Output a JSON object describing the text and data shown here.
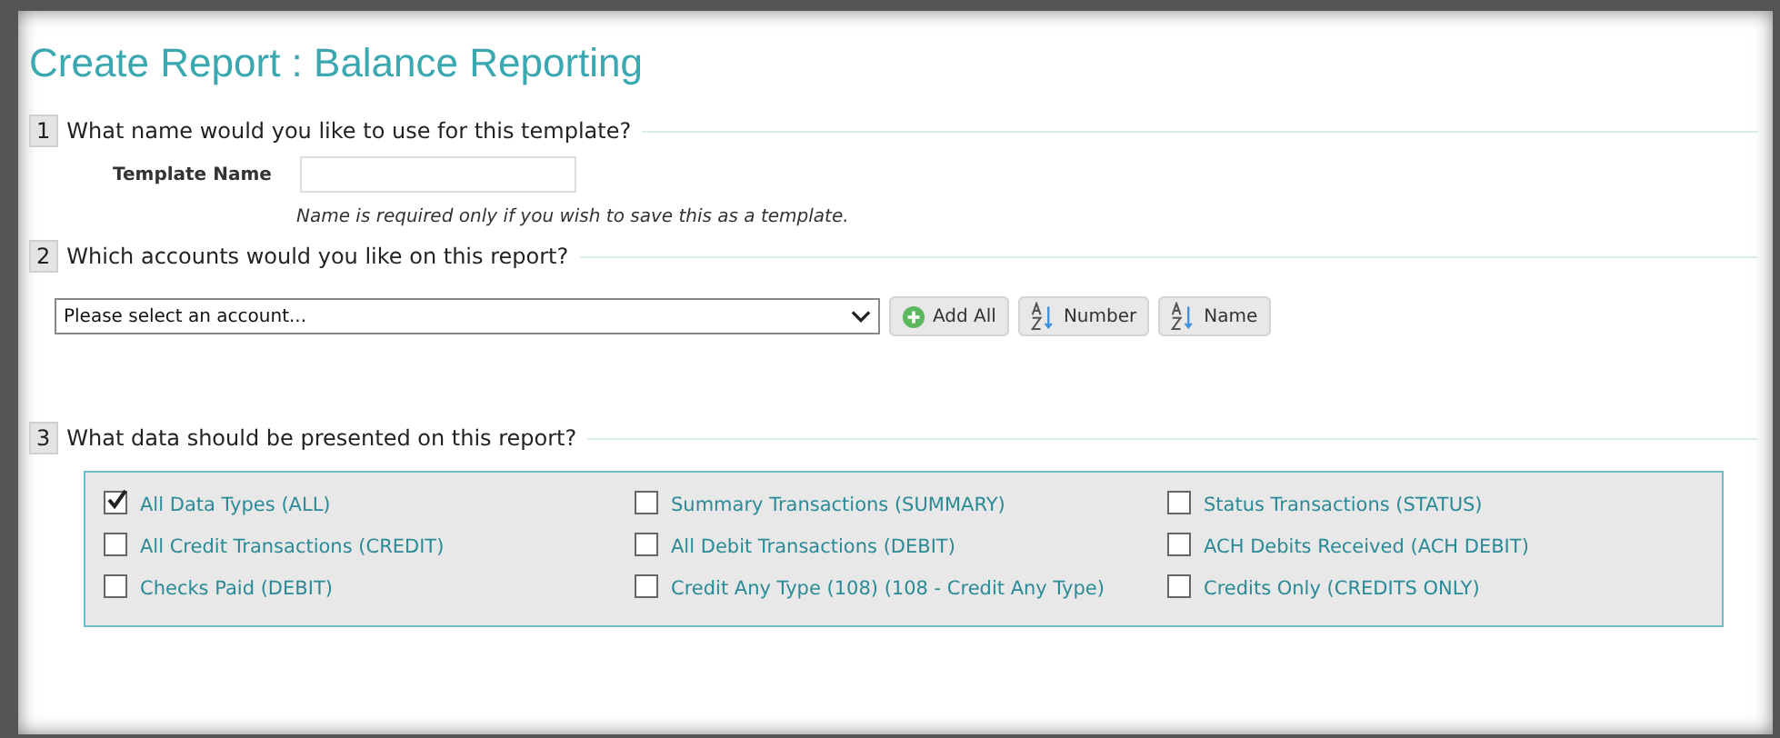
{
  "title": "Create Report : Balance Reporting",
  "sections": [
    {
      "number": "1",
      "question": "What name would you like to use for this template?",
      "kind": "template",
      "field_label": "Template Name",
      "note": "Name is required only if you wish to save this as a template."
    },
    {
      "number": "2",
      "question": "Which accounts would you like on this report?",
      "kind": "accounts",
      "select_value": "Please select an account...",
      "buttons": [
        {
          "label": "Add All",
          "kind": "add"
        },
        {
          "label": "Number",
          "kind": "sort"
        },
        {
          "label": "Name",
          "kind": "sort"
        }
      ]
    },
    {
      "number": "3",
      "question": "What data should be presented on this report?",
      "kind": "data",
      "options": [
        {
          "label": "All Data Types (ALL)",
          "checked": true
        },
        {
          "label": "Summary Transactions (SUMMARY)",
          "checked": false
        },
        {
          "label": "Status Transactions (STATUS)",
          "checked": false
        },
        {
          "label": "All Credit Transactions (CREDIT)",
          "checked": false
        },
        {
          "label": "All Debit Transactions (DEBIT)",
          "checked": false
        },
        {
          "label": "ACH Debits Received (ACH DEBIT)",
          "checked": false
        },
        {
          "label": "Checks Paid (DEBIT)",
          "checked": false
        },
        {
          "label": "Credit Any Type (108) (108 - Credit Any Type)",
          "checked": false
        },
        {
          "label": "Credits Only (CREDITS ONLY)",
          "checked": false
        }
      ]
    }
  ]
}
